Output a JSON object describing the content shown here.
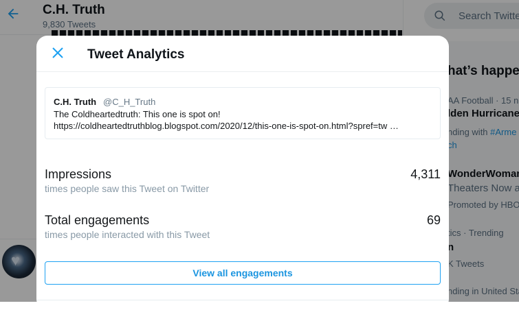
{
  "page": {
    "profile_name": "C.H. Truth",
    "tweet_count": "9,830 Tweets"
  },
  "sidebar": {
    "search_placeholder": "Search Twitter",
    "trends_title": "hat’s happe",
    "trends": [
      {
        "meta": "AA Football · 15 n",
        "title": "lden Hurricane"
      },
      {
        "meta_prefix": "nding with ",
        "meta_tag": "#Arme",
        "meta_tag2": "ch"
      },
      {
        "title": "WonderWoman",
        "sub": "Theaters Now a",
        "promo": "Promoted by HBO"
      },
      {
        "meta": "tics · Trending",
        "title": "n",
        "count": "K Tweets"
      },
      {
        "meta": "nding in United Sta"
      }
    ]
  },
  "modal": {
    "title": "Tweet Analytics",
    "tweet": {
      "author_name": "C.H. Truth",
      "author_handle": "@C_H_Truth",
      "text_line": "The Coldheartedtruth: This one is spot on!",
      "link": "https://coldheartedtruthblog.blogspot.com/2020/12/this-one-is-spot-on.html?spref=tw …"
    },
    "metrics": [
      {
        "label": "Impressions",
        "sub": "times people saw this Tweet on Twitter",
        "value": "4,311"
      },
      {
        "label": "Total engagements",
        "sub": "times people interacted with this Tweet",
        "value": "69"
      }
    ],
    "view_all_label": "View all engagements"
  },
  "colors": {
    "accent": "#1da1f2",
    "link": "#1b95e0",
    "secondary_text": "#8899a6"
  }
}
